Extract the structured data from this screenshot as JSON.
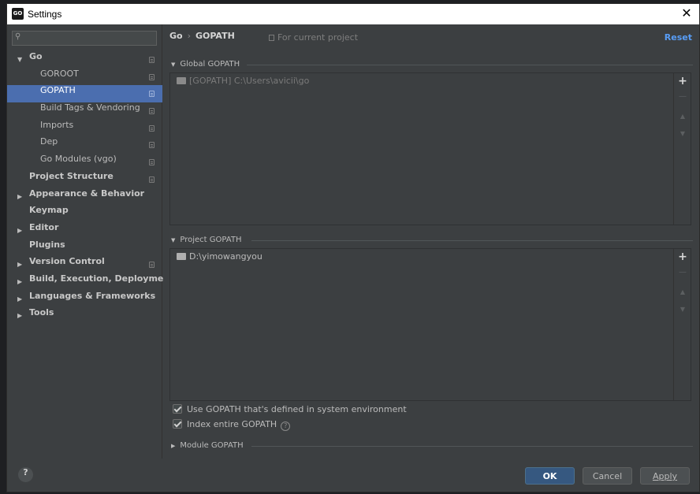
{
  "window": {
    "title": "Settings",
    "app_icon_text": "GO",
    "close_glyph": "✕"
  },
  "search": {
    "placeholder": "",
    "value": "",
    "icon": "search-icon"
  },
  "sidebar": {
    "items": [
      {
        "label": "Go",
        "level": 0,
        "expandable": true,
        "expanded": true,
        "bold": true,
        "project_scoped": true
      },
      {
        "label": "GOROOT",
        "level": 1,
        "project_scoped": true
      },
      {
        "label": "GOPATH",
        "level": 1,
        "project_scoped": true,
        "selected": true
      },
      {
        "label": "Build Tags & Vendoring",
        "level": 1,
        "project_scoped": true
      },
      {
        "label": "Imports",
        "level": 1,
        "project_scoped": true
      },
      {
        "label": "Dep",
        "level": 1,
        "project_scoped": true
      },
      {
        "label": "Go Modules (vgo)",
        "level": 1,
        "project_scoped": true
      },
      {
        "label": "Project Structure",
        "level": 0,
        "bold": true,
        "project_scoped": true
      },
      {
        "label": "Appearance & Behavior",
        "level": 0,
        "expandable": true,
        "bold": true
      },
      {
        "label": "Keymap",
        "level": 0,
        "bold": true
      },
      {
        "label": "Editor",
        "level": 0,
        "expandable": true,
        "bold": true
      },
      {
        "label": "Plugins",
        "level": 0,
        "bold": true
      },
      {
        "label": "Version Control",
        "level": 0,
        "expandable": true,
        "bold": true,
        "project_scoped": true
      },
      {
        "label": "Build, Execution, Deployment",
        "level": 0,
        "expandable": true,
        "bold": true
      },
      {
        "label": "Languages & Frameworks",
        "level": 0,
        "expandable": true,
        "bold": true
      },
      {
        "label": "Tools",
        "level": 0,
        "expandable": true,
        "bold": true
      }
    ]
  },
  "header": {
    "breadcrumb": [
      "Go",
      "GOPATH"
    ],
    "breadcrumb_separator": "›",
    "scope_label": "For current project",
    "reset_label": "Reset"
  },
  "global_gopath": {
    "title": "Global GOPATH",
    "entries": [
      "[GOPATH] C:\\Users\\avicii\\go"
    ]
  },
  "project_gopath": {
    "title": "Project GOPATH",
    "entries": [
      "D:\\yimowangyou"
    ]
  },
  "toolbar": {
    "add": "+",
    "remove": "—",
    "up": "▲",
    "down": "▼"
  },
  "options": {
    "use_system_gopath": {
      "label": "Use GOPATH that's defined in system environment",
      "checked": true
    },
    "index_entire_gopath": {
      "label": "Index entire GOPATH",
      "checked": true,
      "help": "?"
    }
  },
  "module_gopath": {
    "title": "Module GOPATH",
    "expanded": false
  },
  "footer": {
    "help": "?",
    "ok_label": "OK",
    "cancel_label": "Cancel",
    "apply_label": "Apply"
  },
  "colors": {
    "background": "#3c3f41",
    "selection": "#4b6eaf",
    "link": "#589df6",
    "ok_button": "#365880"
  }
}
